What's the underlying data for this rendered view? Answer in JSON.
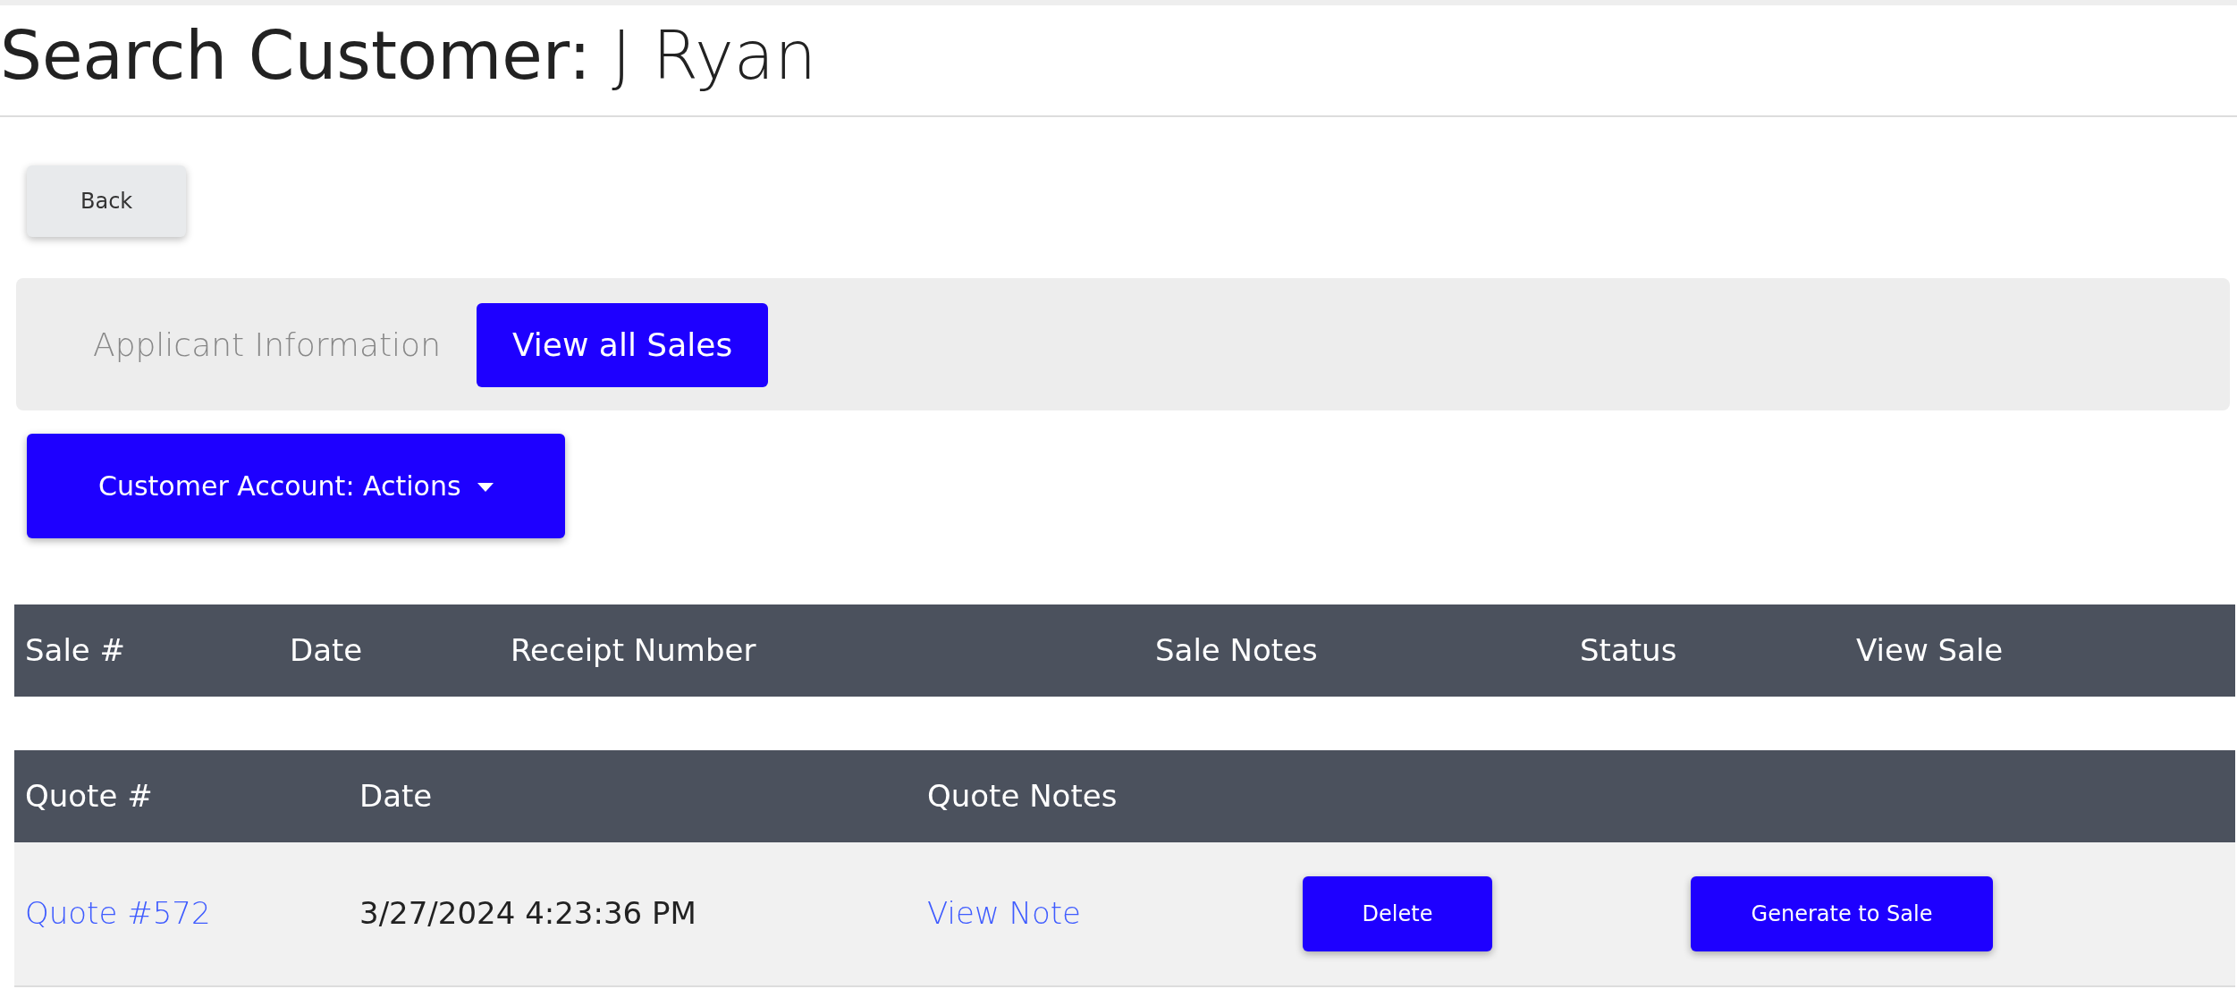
{
  "title": {
    "label": "Search Customer:",
    "name": "J Ryan"
  },
  "back_button": "Back",
  "applicant_panel": {
    "label": "Applicant Information",
    "button": "View all Sales"
  },
  "actions_dropdown": {
    "label": "Customer Account: Actions"
  },
  "sales_table": {
    "columns": [
      "Sale #",
      "Date",
      "Receipt Number",
      "Sale Notes",
      "Status",
      "View Sale"
    ]
  },
  "quotes_table": {
    "columns": [
      "Quote #",
      "Date",
      "Quote Notes"
    ],
    "rows": [
      {
        "quote": "Quote #572",
        "date": "3/27/2024 4:23:36 PM",
        "notes_link": "View Note",
        "delete_button": "Delete",
        "generate_button": "Generate to Sale"
      }
    ]
  }
}
